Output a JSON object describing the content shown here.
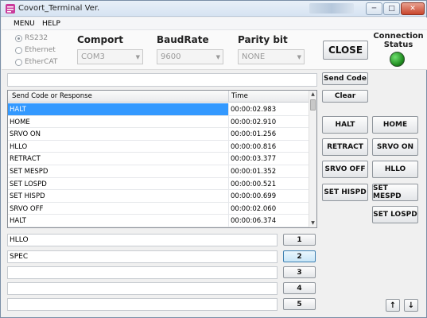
{
  "window": {
    "title": "Covort_Terminal Ver.",
    "minimize": "─",
    "maximize": "□",
    "close": "✕"
  },
  "menu": [
    "MENU",
    "HELP"
  ],
  "connection": {
    "protocols": [
      {
        "label": "RS232",
        "checked": true
      },
      {
        "label": "Ethernet",
        "checked": false
      },
      {
        "label": "EtherCAT",
        "checked": false
      }
    ],
    "comport": {
      "label": "Comport",
      "value": "COM3"
    },
    "baudrate": {
      "label": "BaudRate",
      "value": "9600"
    },
    "parity": {
      "label": "Parity bit",
      "value": "NONE"
    },
    "close_button": "CLOSE",
    "status_label": "Connection Status",
    "status_color": "#1e8a1e"
  },
  "send": {
    "input_value": "",
    "send_button": "Send Code",
    "clear_button": "Clear"
  },
  "table": {
    "columns": [
      "Send Code or Response",
      "Time"
    ],
    "rows": [
      {
        "code": "HALT",
        "time": "00:00:02.983",
        "selected": true
      },
      {
        "code": "HOME",
        "time": "00:00:02.910"
      },
      {
        "code": "SRVO ON",
        "time": "00:00:01.256"
      },
      {
        "code": "HLLO",
        "time": "00:00:00.816"
      },
      {
        "code": "RETRACT",
        "time": "00:00:03.377"
      },
      {
        "code": "SET MESPD",
        "time": "00:00:01.352"
      },
      {
        "code": "SET LOSPD",
        "time": "00:00:00.521"
      },
      {
        "code": "SET HISPD",
        "time": "00:00:00.699"
      },
      {
        "code": "SRVO OFF",
        "time": "00:00:02.060"
      },
      {
        "code": "HALT",
        "time": "00:00:06.374"
      }
    ]
  },
  "commands": [
    "HALT",
    "HOME",
    "RETRACT",
    "SRVO ON",
    "SRVO OFF",
    "HLLO",
    "SET HISPD",
    "SET MESPD",
    "SET LOSPD"
  ],
  "macros": [
    {
      "value": "HLLO",
      "button": "1"
    },
    {
      "value": "SPEC",
      "button": "2"
    },
    {
      "value": "",
      "button": "3"
    },
    {
      "value": "",
      "button": "4"
    },
    {
      "value": "",
      "button": "5"
    }
  ],
  "nav": {
    "up": "↑",
    "down": "↓"
  }
}
